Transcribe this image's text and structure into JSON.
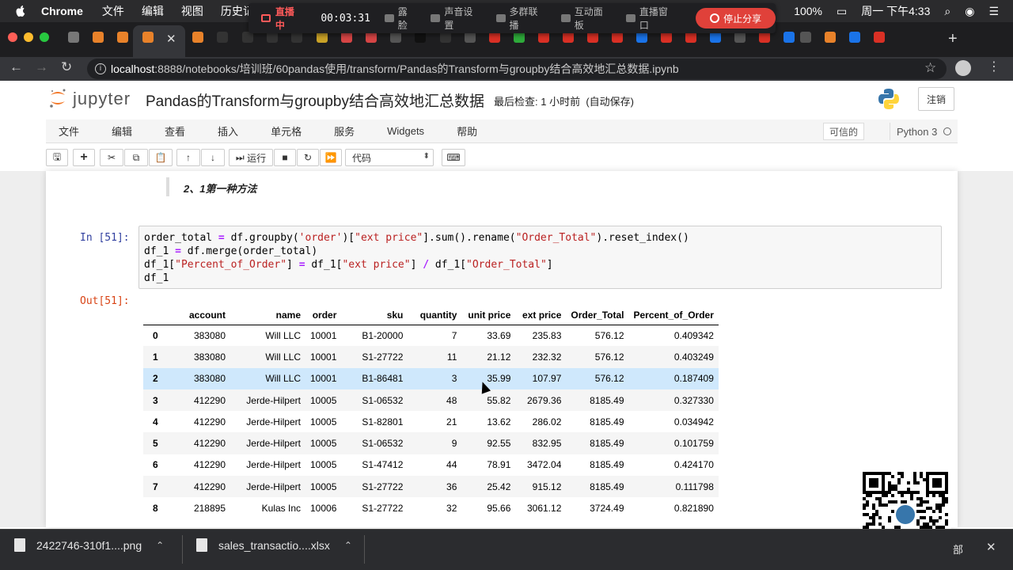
{
  "macos": {
    "app_name": "Chrome",
    "menus": [
      "文件",
      "编辑",
      "视图",
      "历史记"
    ],
    "battery": "100%",
    "clock": "周一 下午4:33"
  },
  "streaming": {
    "status": "直播中",
    "timer": "00:03:31",
    "items": [
      "露脸",
      "声音设置",
      "多群联播",
      "互动面板",
      "直播窗口"
    ],
    "stop_label": "停止分享"
  },
  "browser": {
    "url_host": "localhost",
    "url_path": ":8888/notebooks/培训班/60pandas使用/transform/Pandas的Transform与groupby结合高效地汇总数据.ipynb"
  },
  "jupyter": {
    "logo_text": "jupyter",
    "notebook_title": "Pandas的Transform与groupby结合高效地汇总数据",
    "checkpoint": "最后检查: 1 小时前",
    "autosave": "(自动保存)",
    "logout_label": "注销",
    "menu": [
      "文件",
      "编辑",
      "查看",
      "插入",
      "单元格",
      "服务",
      "Widgets",
      "帮助"
    ],
    "trusted": "可信的",
    "kernel": "Python 3",
    "toolbar": {
      "run_label": "运行",
      "cell_type": "代码"
    }
  },
  "markdown_cell": "2、1第一种方法",
  "code_cell": {
    "prompt": "In [51]:",
    "lines": [
      [
        "order_total ",
        "= ",
        "df.groupby(",
        "'order'",
        ")[",
        "\"ext price\"",
        "].sum().rename(",
        "\"Order_Total\"",
        ").reset_index()"
      ],
      [
        "df_1 ",
        "= ",
        "df.merge(order_total)"
      ],
      [
        "df_1[",
        "\"Percent_of_Order\"",
        "] ",
        "= ",
        "df_1[",
        "\"ext price\"",
        "] ",
        "/ ",
        "df_1[",
        "\"Order_Total\"",
        "]"
      ],
      [
        "df_1"
      ]
    ]
  },
  "output": {
    "prompt": "Out[51]:",
    "columns": [
      "",
      "account",
      "name",
      "order",
      "sku",
      "quantity",
      "unit price",
      "ext price",
      "Order_Total",
      "Percent_of_Order"
    ],
    "rows": [
      [
        "0",
        "383080",
        "Will LLC",
        "10001",
        "B1-20000",
        "7",
        "33.69",
        "235.83",
        "576.12",
        "0.409342"
      ],
      [
        "1",
        "383080",
        "Will LLC",
        "10001",
        "S1-27722",
        "11",
        "21.12",
        "232.32",
        "576.12",
        "0.403249"
      ],
      [
        "2",
        "383080",
        "Will LLC",
        "10001",
        "B1-86481",
        "3",
        "35.99",
        "107.97",
        "576.12",
        "0.187409"
      ],
      [
        "3",
        "412290",
        "Jerde-Hilpert",
        "10005",
        "S1-06532",
        "48",
        "55.82",
        "2679.36",
        "8185.49",
        "0.327330"
      ],
      [
        "4",
        "412290",
        "Jerde-Hilpert",
        "10005",
        "S1-82801",
        "21",
        "13.62",
        "286.02",
        "8185.49",
        "0.034942"
      ],
      [
        "5",
        "412290",
        "Jerde-Hilpert",
        "10005",
        "S1-06532",
        "9",
        "92.55",
        "832.95",
        "8185.49",
        "0.101759"
      ],
      [
        "6",
        "412290",
        "Jerde-Hilpert",
        "10005",
        "S1-47412",
        "44",
        "78.91",
        "3472.04",
        "8185.49",
        "0.424170"
      ],
      [
        "7",
        "412290",
        "Jerde-Hilpert",
        "10005",
        "S1-27722",
        "36",
        "25.42",
        "915.12",
        "8185.49",
        "0.111798"
      ],
      [
        "8",
        "218895",
        "Kulas Inc",
        "10006",
        "S1-27722",
        "32",
        "95.66",
        "3061.12",
        "3724.49",
        "0.821890"
      ]
    ],
    "highlight_row": 2
  },
  "downloads": {
    "items": [
      "2422746-310f1....png",
      "sales_transactio....xlsx"
    ],
    "show_all": "部"
  },
  "colors": {
    "tab_icons": [
      "#777777",
      "#e8822a",
      "#e8822a",
      "#e8822a",
      "#e8822a",
      "#333333",
      "#333333",
      "#333333",
      "#333333",
      "#c9a227",
      "#d64545",
      "#d64545",
      "#555555",
      "#111111",
      "#333333",
      "#555555",
      "#d93025",
      "#2eaa3a",
      "#d93025",
      "#d93025",
      "#d93025",
      "#d93025",
      "#1a73e8",
      "#d93025",
      "#d93025",
      "#1a73e8",
      "#555555",
      "#d93025",
      "#1a73e8",
      "#555555",
      "#e8822a",
      "#1a73e8",
      "#d93025"
    ]
  }
}
